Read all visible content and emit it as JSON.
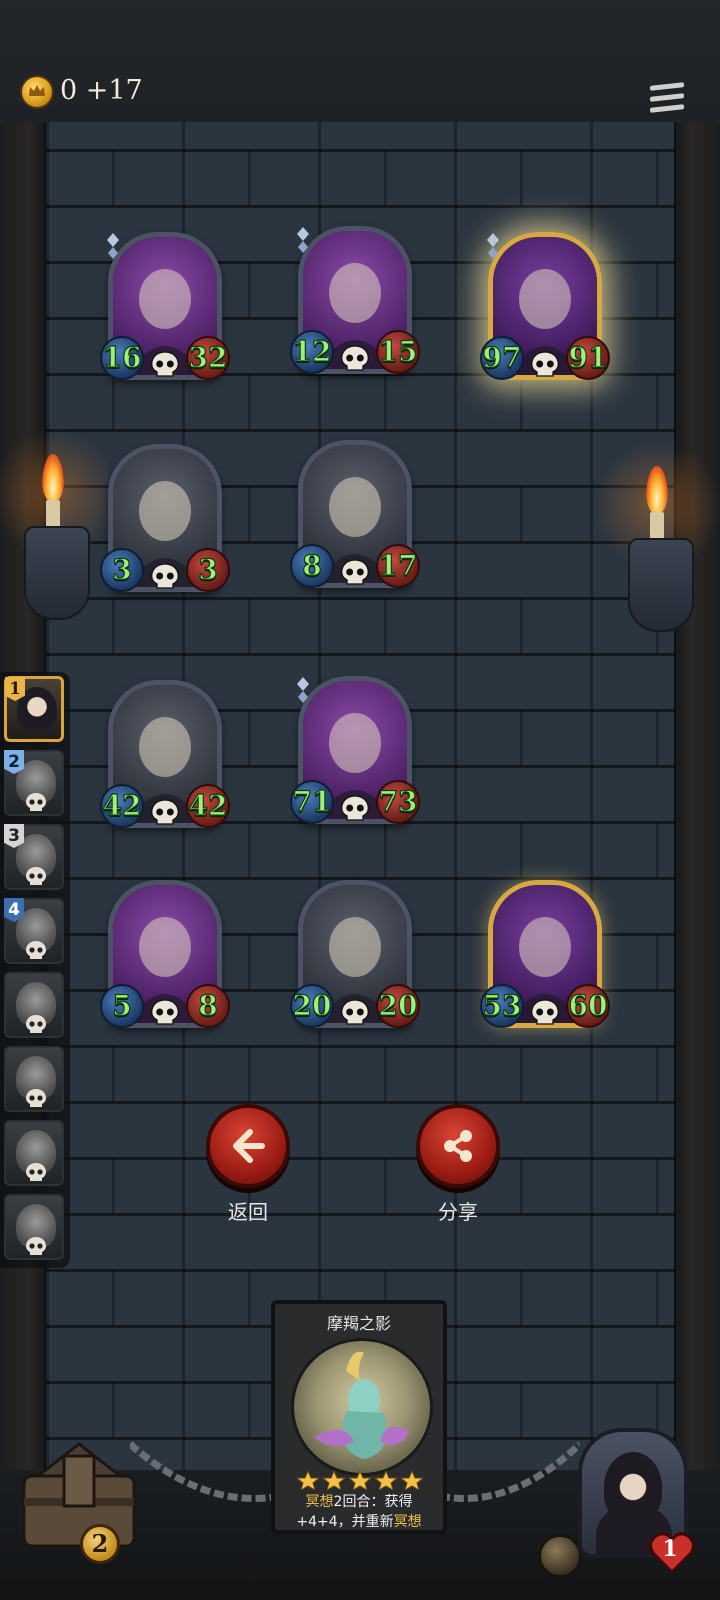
{
  "header": {
    "gold_value": "0 +17"
  },
  "icons": {
    "coin": "crown-coin-icon",
    "menu": "hamburger-menu-icon",
    "back": "arrow-left-icon",
    "share": "share-icon",
    "death": "skull-icon",
    "life": "heart-icon"
  },
  "colors": {
    "attack_badge": "#2f5a94",
    "health_badge": "#9b2c24",
    "stat_text": "#9df07a",
    "gold_frame": "#d8a941",
    "button_red": "#b52a1e",
    "highlight_text": "#f0c04a"
  },
  "sidebar": {
    "items": [
      {
        "num": "1",
        "active": true
      },
      {
        "num": "2"
      },
      {
        "num": "3"
      },
      {
        "num": "4"
      },
      {
        "num": ""
      },
      {
        "num": ""
      },
      {
        "num": ""
      },
      {
        "num": ""
      }
    ]
  },
  "board": {
    "cards": [
      {
        "name": "goggle-bandit",
        "attack": "16",
        "health": "32",
        "rarity": "purple",
        "diamond": true
      },
      {
        "name": "armored-knight-drone",
        "attack": "12",
        "health": "15",
        "rarity": "purple",
        "diamond": true
      },
      {
        "name": "steam-cannon",
        "attack": "97",
        "health": "91",
        "rarity": "gold",
        "diamond": true,
        "highlighted": true
      },
      {
        "name": "bell-robot",
        "attack": "3",
        "health": "3",
        "rarity": "stone"
      },
      {
        "name": "goggle-bandit",
        "attack": "8",
        "health": "17",
        "rarity": "stone"
      },
      {
        "name": "bell-robot",
        "attack": "42",
        "health": "42",
        "rarity": "stone"
      },
      {
        "name": "airship",
        "attack": "71",
        "health": "73",
        "rarity": "purple",
        "diamond": true
      },
      {
        "name": "scar-wolf",
        "attack": "5",
        "health": "8",
        "rarity": "purple"
      },
      {
        "name": "jester-clown",
        "attack": "20",
        "health": "20",
        "rarity": "stone"
      },
      {
        "name": "blue-hair-sorceress",
        "attack": "53",
        "health": "60",
        "rarity": "gold"
      }
    ]
  },
  "actions": {
    "back_label": "返回",
    "share_label": "分享"
  },
  "info_card": {
    "title": "摩羯之影",
    "stars": 5,
    "text_kw1": "冥想",
    "text_part1": "2回合：获得",
    "text_part2": "+4+4，并重新",
    "text_kw2": "冥想"
  },
  "bottom": {
    "chest_count": "2",
    "lives": "1"
  }
}
